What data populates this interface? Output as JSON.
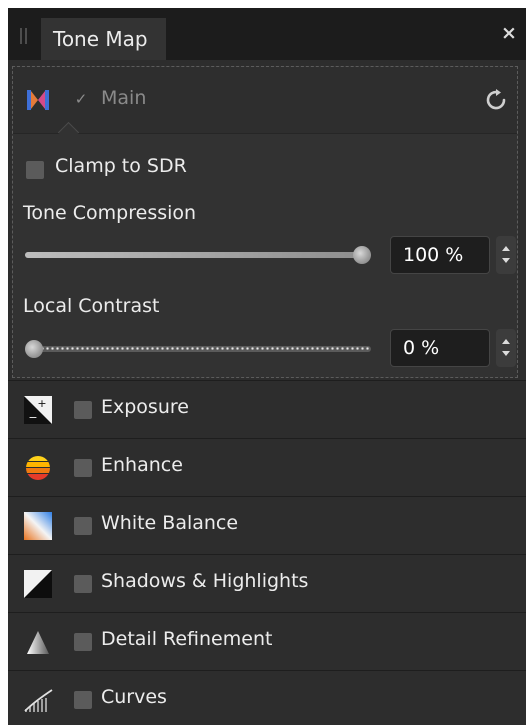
{
  "panel": {
    "tab_title": "Tone Map",
    "close_glyph": "×"
  },
  "main": {
    "icon": "tone-map-icon",
    "label": "Main",
    "enabled": true,
    "check_glyph": "✓",
    "reset_icon": "reset-icon"
  },
  "clamp_to_sdr": {
    "label": "Clamp to SDR",
    "checked": false
  },
  "tone_compression": {
    "label": "Tone Compression",
    "value": 100,
    "display": "100 %"
  },
  "local_contrast": {
    "label": "Local Contrast",
    "value": 0,
    "display": "0 %"
  },
  "filters": [
    {
      "name": "exposure",
      "label": "Exposure",
      "icon": "exposure-icon",
      "checked": false
    },
    {
      "name": "enhance",
      "label": "Enhance",
      "icon": "enhance-icon",
      "checked": false
    },
    {
      "name": "white-balance",
      "label": "White Balance",
      "icon": "white-balance-icon",
      "checked": false
    },
    {
      "name": "shadows-highlights",
      "label": "Shadows & Highlights",
      "icon": "shadows-highlights-icon",
      "checked": false
    },
    {
      "name": "detail-refinement",
      "label": "Detail Refinement",
      "icon": "detail-refinement-icon",
      "checked": false
    },
    {
      "name": "curves",
      "label": "Curves",
      "icon": "curves-icon",
      "checked": false
    }
  ],
  "colors": {
    "panel_bg": "#2d2d2d",
    "header_bg": "#1c1c1c",
    "text": "#ececec"
  }
}
